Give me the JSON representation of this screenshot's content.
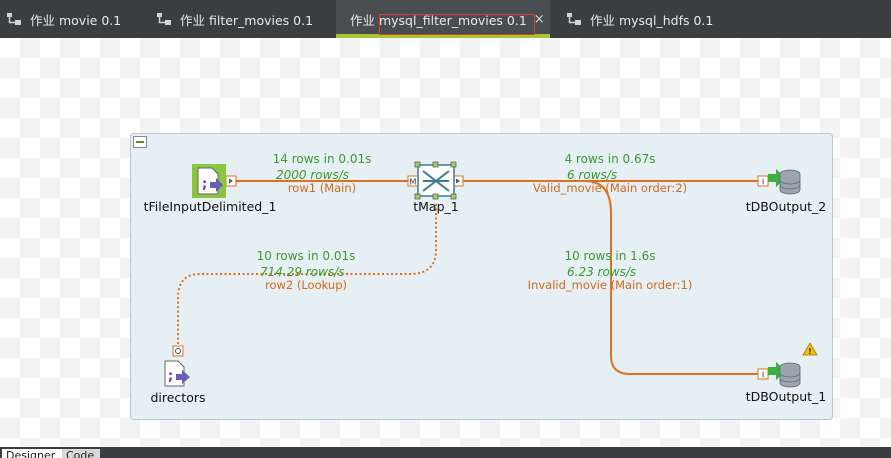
{
  "tabs": [
    {
      "label": "作业 movie 0.1",
      "active": false,
      "icon": "job-icon"
    },
    {
      "label": "作业 filter_movies 0.1",
      "active": false,
      "icon": "job-icon"
    },
    {
      "label": "作业 mysql_filter_movies 0.1",
      "active": true,
      "icon": "job-icon",
      "close": "×"
    },
    {
      "label": "作业 mysql_hdfs 0.1",
      "active": false,
      "icon": "job-icon"
    }
  ],
  "components": {
    "file_input": {
      "label": "tFileInputDelimited_1",
      "icon": "file-input-icon"
    },
    "tmap": {
      "label": "tMap_1",
      "icon": "tmap-icon"
    },
    "db_output_2": {
      "label": "tDBOutput_2",
      "icon": "db-output-icon"
    },
    "directors": {
      "label": "directors",
      "icon": "file-input-icon"
    },
    "db_output_1": {
      "label": "tDBOutput_1",
      "icon": "db-output-icon",
      "warning": "warning-icon"
    }
  },
  "connections": {
    "row1": {
      "stat": "14 rows in 0.01s",
      "rate": "2000 rows/s",
      "label": "row1 (Main)"
    },
    "row2": {
      "stat": "10 rows in 0.01s",
      "rate": "714.29 rows/s",
      "label": "row2 (Lookup)"
    },
    "valid": {
      "stat": "4 rows in 0.67s",
      "rate": "6 rows/s",
      "label": "Valid_movie (Main order:2)"
    },
    "invalid": {
      "stat": "10 rows in 1.6s",
      "rate": "6.23 rows/s",
      "label": "Invalid_movie (Main order:1)"
    }
  },
  "bottom_tabs": [
    {
      "label": "Designer",
      "active": true
    },
    {
      "label": "Code",
      "active": false
    }
  ],
  "colors": {
    "link": "#e07020",
    "stats": "#3c9a2c",
    "active_tab_underline": "#a4c832",
    "highlight": "#e23b3b"
  }
}
